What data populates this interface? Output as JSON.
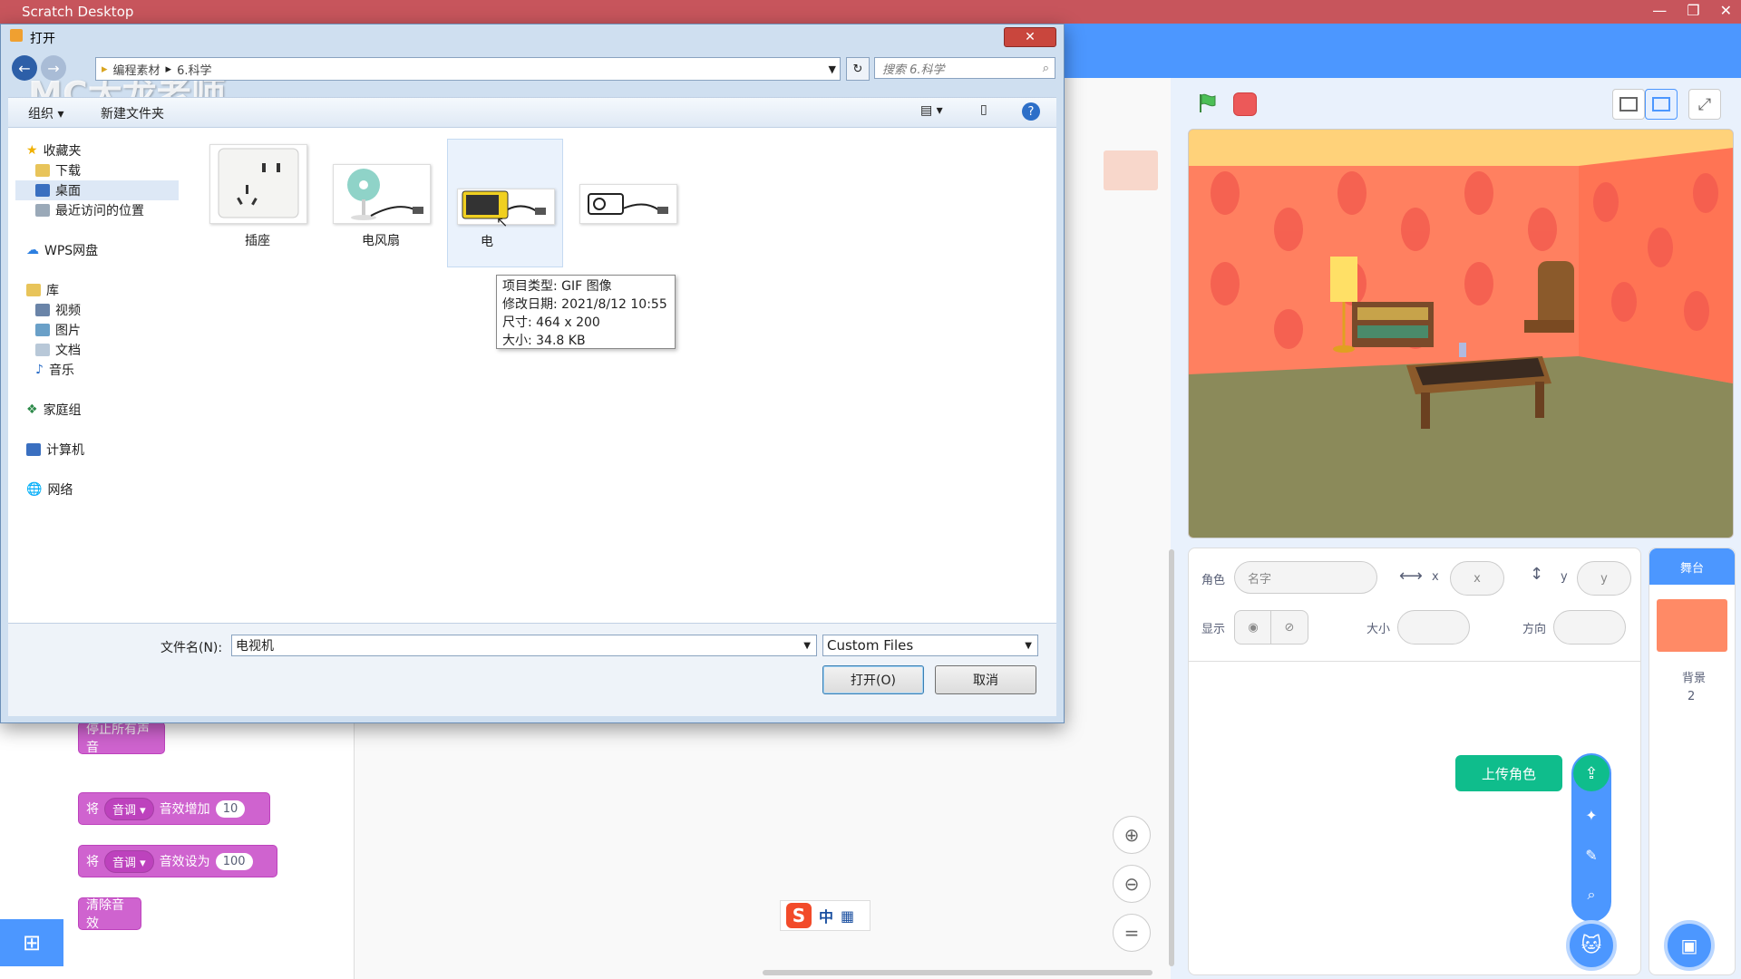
{
  "app": {
    "title": "Scratch Desktop"
  },
  "watermark": "MC大龙老师",
  "dialog": {
    "title": "打开",
    "close": "✕",
    "path": [
      "编程素材",
      "6.科学"
    ],
    "search_placeholder": "搜索 6.科学",
    "organize": "组织",
    "new_folder": "新建文件夹",
    "nav": {
      "favorites": "收藏夹",
      "downloads": "下载",
      "desktop": "桌面",
      "recent": "最近访问的位置",
      "wps": "WPS网盘",
      "library": "库",
      "videos": "视频",
      "pictures": "图片",
      "documents": "文档",
      "music": "音乐",
      "homegroup": "家庭组",
      "computer": "计算机",
      "network": "网络"
    },
    "files": [
      {
        "name": "插座"
      },
      {
        "name": "电风扇"
      },
      {
        "name": "电"
      },
      {
        "name": ""
      }
    ],
    "tooltip": {
      "type": "项目类型: GIF 图像",
      "date": "修改日期: 2021/8/12 10:55",
      "dims": "尺寸: 464 x 200",
      "size": "大小: 34.8 KB"
    },
    "filename_label": "文件名(N):",
    "filename_value": "电视机",
    "filter": "Custom Files",
    "open_btn": "打开(O)",
    "cancel_btn": "取消"
  },
  "blocks": {
    "stop_sounds": "停止所有声音",
    "change_effect": {
      "prefix": "将",
      "dropdown": "音调",
      "action": "音效增加",
      "value": "10"
    },
    "set_effect": {
      "prefix": "将",
      "dropdown": "音调",
      "action": "音效设为",
      "value": "100"
    },
    "clear_effects": "清除音效"
  },
  "sprite_info": {
    "sprite_label": "角色",
    "name_placeholder": "名字",
    "x_label": "x",
    "x_value": "x",
    "y_label": "y",
    "y_value": "y",
    "show_label": "显示",
    "size_label": "大小",
    "direction_label": "方向"
  },
  "stage_panel": {
    "title": "舞台",
    "backdrops_label": "背景",
    "backdrops_count": "2"
  },
  "upload_tooltip": "上传角色",
  "ime": {
    "mode": "中"
  },
  "colors": {
    "scratch_blue": "#4c97ff",
    "sound_purple": "#cf63cf",
    "titlebar": "#c7555c",
    "green_flag": "#4cbf56"
  }
}
